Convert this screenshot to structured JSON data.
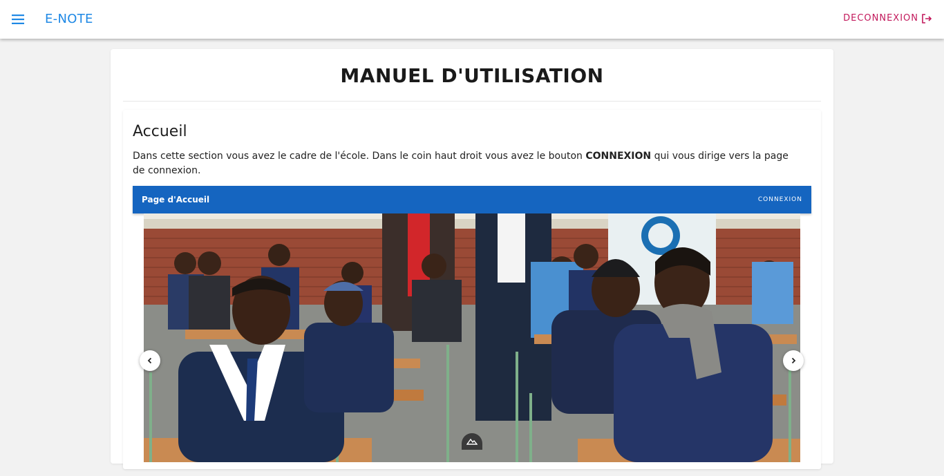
{
  "header": {
    "app_title": "E-NOTE",
    "logout_label": "DECONNEXION",
    "menu_icon": "menu-icon",
    "logout_icon": "logout-icon"
  },
  "main": {
    "page_title": "MANUEL D'UTILISATION",
    "section": {
      "title": "Accueil",
      "text_before": "Dans cette section vous avez le cadre de l'école. Dans le coin haut droit vous avez le bouton ",
      "text_bold": "CONNEXION",
      "text_after": " qui vous dirige vers la page de connexion.",
      "preview": {
        "bar_title": "Page d'Accueil",
        "bar_button": "CONNEXION",
        "image_subject": "photo of students in school uniforms seated at classroom desks",
        "prev_icon": "chevron-left-icon",
        "next_icon": "chevron-right-icon"
      }
    }
  },
  "colors": {
    "accent": "#1e88e5",
    "logout": "#c2185b",
    "preview_bar": "#1565c0",
    "background": "#f2f2f2"
  }
}
